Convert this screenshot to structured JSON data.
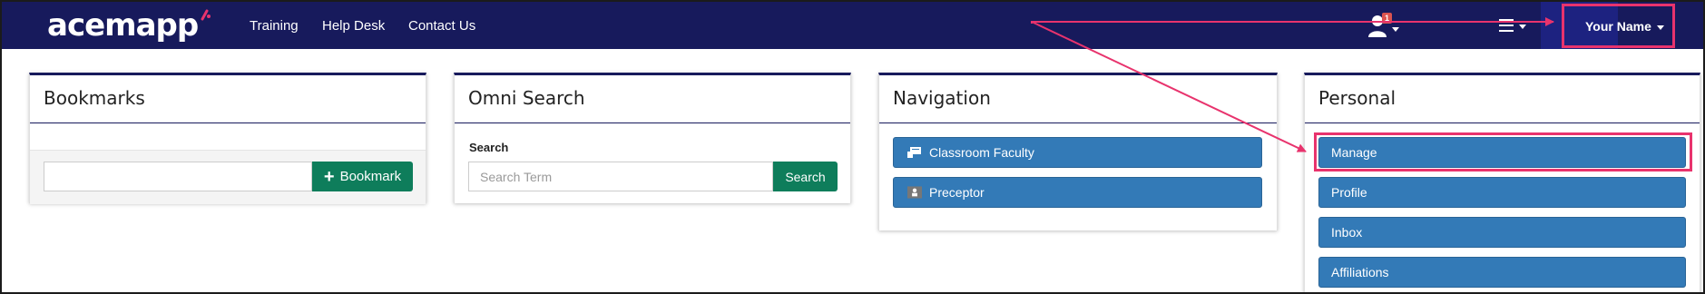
{
  "header": {
    "logo_text": "acemapp",
    "nav_links": [
      "Training",
      "Help Desk",
      "Contact Us"
    ],
    "notification_count": "1",
    "user_menu_label": "Your Name"
  },
  "panels": {
    "bookmarks": {
      "title": "Bookmarks",
      "input_value": "",
      "button_label": "Bookmark"
    },
    "omni": {
      "title": "Omni Search",
      "field_label": "Search",
      "placeholder": "Search Term",
      "button_label": "Search"
    },
    "navigation": {
      "title": "Navigation",
      "items": [
        "Classroom Faculty",
        "Preceptor"
      ]
    },
    "personal": {
      "title": "Personal",
      "items": [
        "Manage",
        "Profile",
        "Inbox",
        "Affiliations"
      ]
    }
  },
  "icons": [
    "user-icon",
    "caret-down-icon",
    "hamburger-icon",
    "plus-icon",
    "chalkboard-icon",
    "id-badge-icon"
  ],
  "colors": {
    "nav_bg": "#171a5c",
    "primary_button": "#337ab7",
    "success_button": "#0e7d5b",
    "annotation": "#e8336d",
    "badge": "#d9534f"
  }
}
